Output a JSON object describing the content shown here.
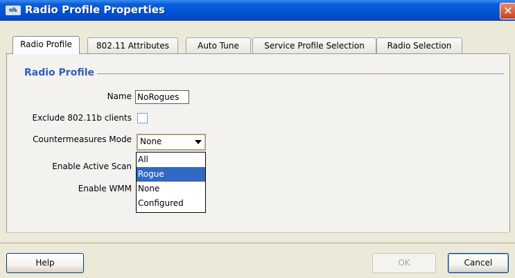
{
  "window": {
    "title": "Radio Profile Properties",
    "icon_text": "⊕℞",
    "close_glyph": "✕"
  },
  "tabs": [
    {
      "label": "Radio Profile",
      "active": true
    },
    {
      "label": "802.11 Attributes",
      "active": false
    },
    {
      "label": "Auto Tune",
      "active": false
    },
    {
      "label": "Service Profile Selection",
      "active": false
    },
    {
      "label": "Radio Selection",
      "active": false
    }
  ],
  "section": {
    "title": "Radio Profile"
  },
  "form": {
    "name_label": "Name",
    "name_value": "NoRogues",
    "exclude_label": "Exclude 802.11b clients",
    "exclude_checked": false,
    "countermeasures_label": "Countermeasures Mode",
    "countermeasures_value": "None",
    "active_scan_label": "Enable Active Scan",
    "wmm_label": "Enable WMM"
  },
  "dropdown": {
    "options": [
      "All",
      "Rogue",
      "None",
      "Configured"
    ],
    "highlighted": "Rogue"
  },
  "buttons": {
    "help": "Help",
    "ok": "OK",
    "cancel": "Cancel"
  },
  "colors": {
    "titlebar": "#0052d4",
    "section_title": "#2f5ec2",
    "selection": "#316ac5"
  }
}
